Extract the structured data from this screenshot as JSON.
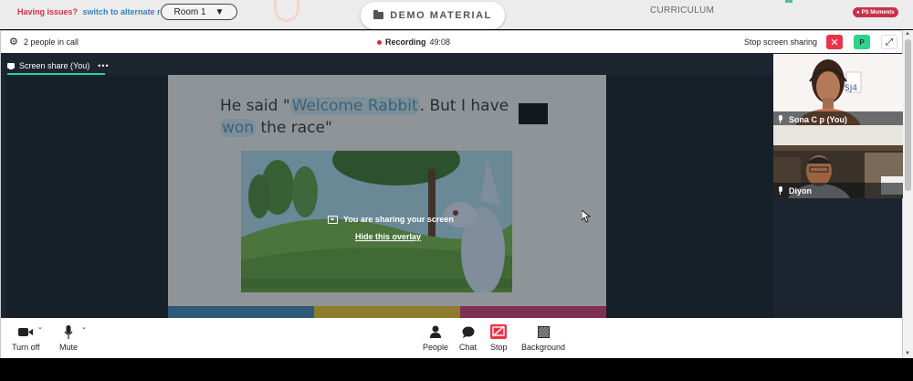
{
  "topbar": {
    "issue_text": "Having issues?",
    "switch_link": "switch to alternate room",
    "room": "Room 1",
    "demo_material": "DEMO MATERIAL",
    "curriculum": "CURRICULUM",
    "moments": "PS Moments"
  },
  "call": {
    "people_count": "2 people in call",
    "recording_label": "Recording",
    "recording_time": "49:08",
    "stop_share": "Stop screen sharing",
    "close_symbol": "✕",
    "participant_initial": "P",
    "expand_symbol": "⤢",
    "share_tab": "Screen share (You)",
    "share_tab_menu": "•••"
  },
  "slide": {
    "line_start": "He said \"",
    "hl1": "Welcome Rabbit",
    "mid": ". But I have ",
    "hl2": "won",
    "line_end": " the race\"",
    "strip_colors": [
      "#3d7fae",
      "#e5b82a",
      "#c43a68"
    ]
  },
  "overlay": {
    "message": "You are sharing your screen",
    "hide_link": "Hide this overlay"
  },
  "participants": [
    {
      "name": "Sona C p (You)"
    },
    {
      "name": "Diyon"
    }
  ],
  "tray": {
    "turn_off": "Turn off",
    "mute": "Mute",
    "people": "People",
    "chat": "Chat",
    "stop": "Stop",
    "background": "Background"
  },
  "colors": {
    "accent_green": "#27d0a0",
    "record_red": "#e0282f",
    "stop_red": "#e8344a",
    "link_blue": "#3b7fc4"
  }
}
